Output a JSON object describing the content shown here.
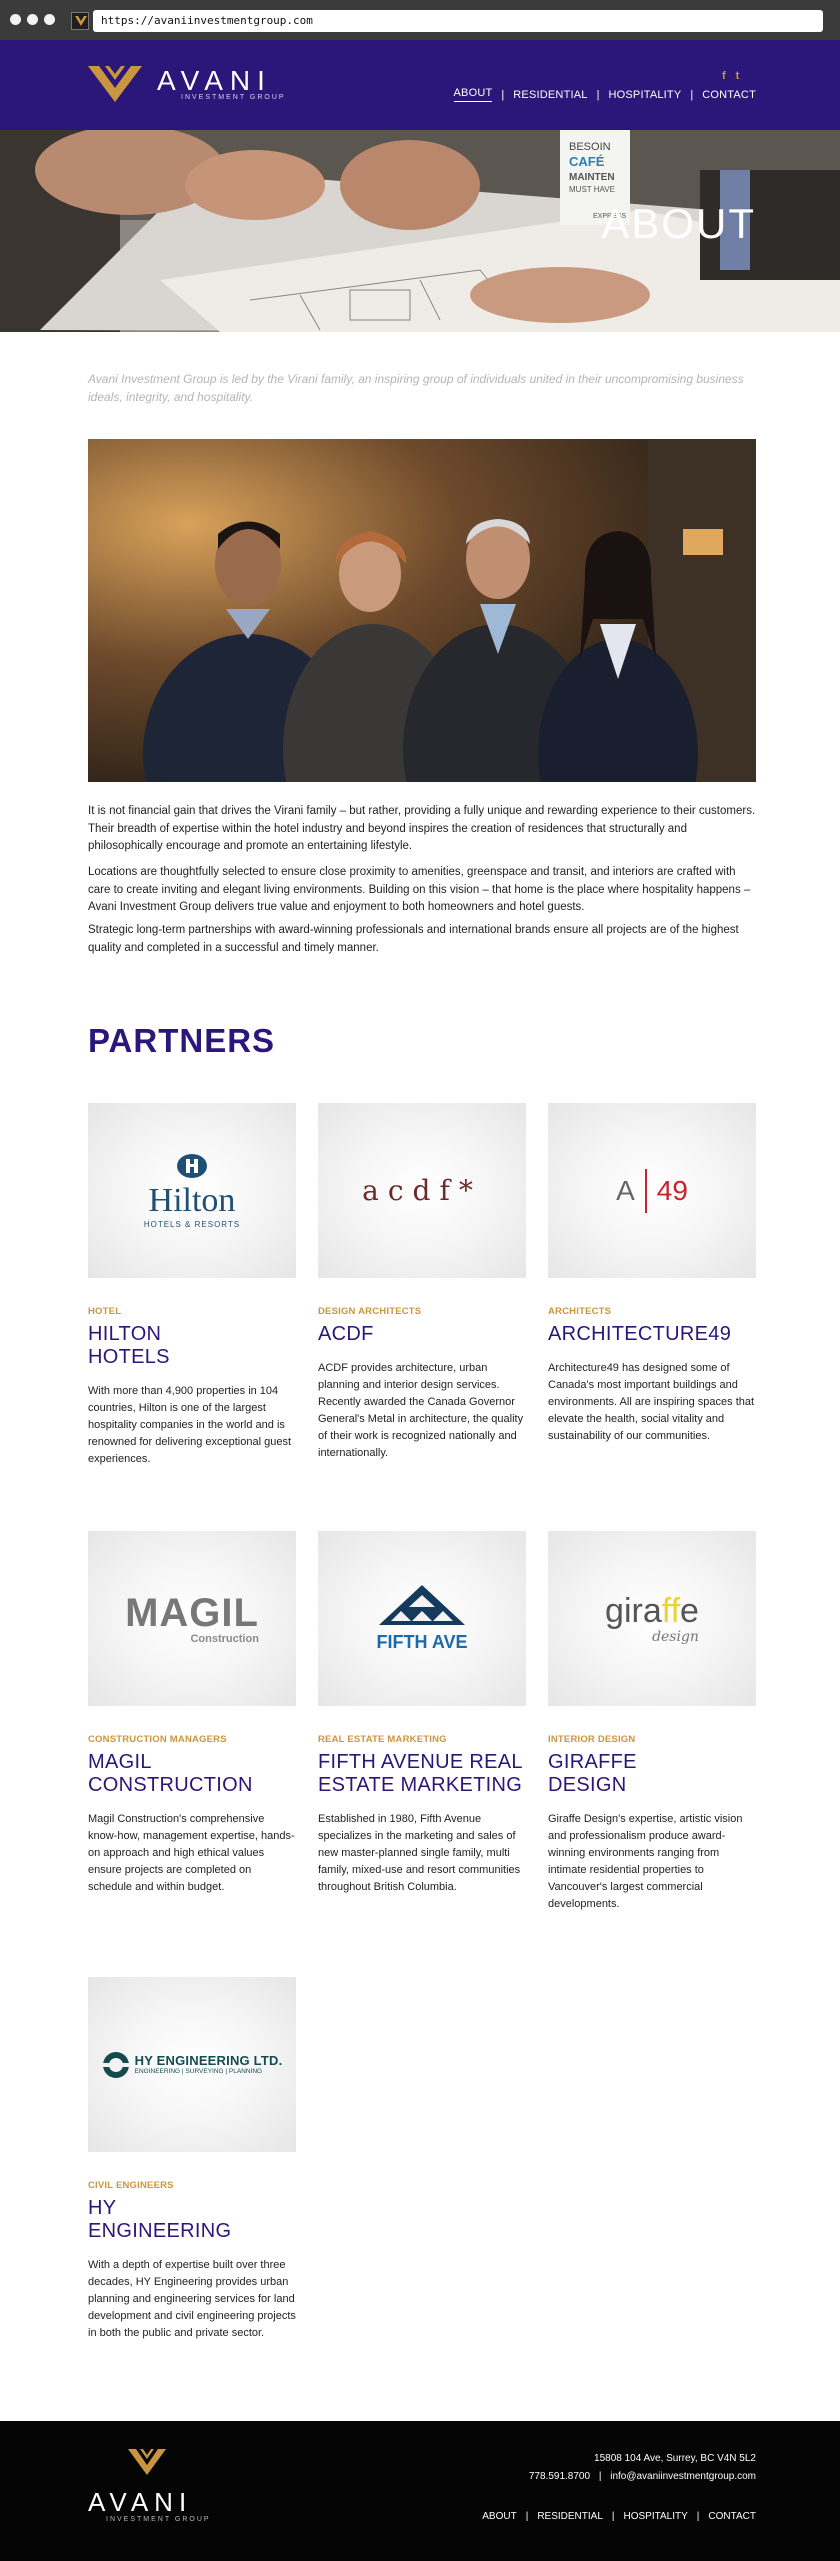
{
  "browser": {
    "url": "https://avaniinvestmentgroup.com"
  },
  "header": {
    "brand": "AVANI",
    "brand_sub": "INVESTMENT GROUP",
    "social": {
      "facebook": "f",
      "twitter": "t"
    },
    "nav": [
      {
        "label": "ABOUT"
      },
      {
        "label": "RESIDENTIAL"
      },
      {
        "label": "HOSPITALITY"
      },
      {
        "label": "CONTACT"
      }
    ]
  },
  "hero": {
    "title": "ABOUT",
    "cup_text": [
      "BESOIN",
      "CAFÉ",
      "MAINTEN",
      "MUST HAVE",
      "EXPRESS"
    ]
  },
  "intro": "Avani Investment Group is led by the Virani family, an inspiring group of individuals united in their uncompromising business ideals, integrity, and hospitality.",
  "paragraphs": [
    "It is not financial gain that drives the Virani family – but rather, providing a fully unique and rewarding experience to their customers. Their breadth of expertise within the hotel industry and beyond inspires the creation of residences that structurally and philosophically encourage and promote an entertaining lifestyle.",
    "Locations are thoughtfully selected to ensure close proximity to amenities, greenspace and transit, and interiors are crafted with care to create inviting and elegant living environments. Building on this vision – that home is the place where hospitality happens – Avani Investment Group delivers true value and enjoyment to both homeowners and hotel guests.",
    "Strategic long-term partnerships with award-winning professionals and international brands ensure all projects are of the highest quality and completed in a successful and timely manner."
  ],
  "partners": {
    "title": "PARTNERS",
    "items": [
      {
        "logo_text": "Hilton",
        "logo_sub": "HOTELS & RESORTS",
        "category": "HOTEL",
        "name": [
          "HILTON",
          "HOTELS"
        ],
        "description": "With more than 4,900 properties in 104 countries, Hilton is one of the largest hospitality companies in the world and is renowned for delivering exceptional guest experiences."
      },
      {
        "logo_text": "acdf*",
        "category": "DESIGN ARCHITECTS",
        "name": [
          "ACDF"
        ],
        "description": "ACDF provides architecture, urban planning and interior design services. Recently awarded the Canada Governor General's Metal in architecture, the quality of their work is recognized nationally and internationally."
      },
      {
        "logo_text_a": "A",
        "logo_text_b": "49",
        "category": "ARCHITECTS",
        "name": [
          "ARCHITECTURE49"
        ],
        "description": "Architecture49 has designed some of Canada's most important buildings and environments. All are inspiring spaces that elevate the health, social vitality and sustainability of our communities."
      },
      {
        "logo_text": "MAGIL",
        "logo_sub": "Construction",
        "category": "CONSTRUCTION MANAGERS",
        "name": [
          "MAGIL",
          "CONSTRUCTION"
        ],
        "description": "Magil Construction's comprehensive know-how, management expertise, hands-on approach and high ethical values ensure projects are completed on schedule and within budget."
      },
      {
        "logo_text": "FIFTH AVE",
        "category": "REAL ESTATE MARKETING",
        "name": [
          "FIFTH AVENUE REAL",
          "ESTATE MARKETING"
        ],
        "description": "Established in 1980, Fifth Avenue specializes in the marketing and sales of new master-planned single family, multi family, mixed-use and resort communities throughout British Columbia."
      },
      {
        "logo_text_a": "gira",
        "logo_text_b": "ff",
        "logo_text_c": "e",
        "logo_sub": "design",
        "category": "INTERIOR DESIGN",
        "name": [
          "GIRAFFE",
          "DESIGN"
        ],
        "description": "Giraffe Design's expertise, artistic vision and professionalism produce award-winning environments ranging from intimate residential properties to Vancouver's largest commercial developments."
      },
      {
        "logo_text": "HY ENGINEERING LTD.",
        "logo_sub": "ENGINEERING | SURVEYING | PLANNING",
        "category": "CIVIL ENGINEERS",
        "name": [
          "HY",
          "ENGINEERING"
        ],
        "description": "With a depth of expertise built over three decades, HY Engineering provides urban planning and engineering services for land development and civil engineering projects in both the public and private sector."
      }
    ]
  },
  "footer": {
    "brand": "AVANI",
    "brand_sub": "INVESTMENT GROUP",
    "address": "15808 104 Ave, Surrey, BC V4N 5L2",
    "phone": "778.591.8700",
    "email": "info@avaniinvestmentgroup.com",
    "nav": [
      {
        "label": "ABOUT"
      },
      {
        "label": "RESIDENTIAL"
      },
      {
        "label": "HOSPITALITY"
      },
      {
        "label": "CONTACT"
      }
    ]
  },
  "colors": {
    "brand_purple": "#2b167a",
    "accent_gold": "#c9963f",
    "footer_black": "#050505"
  }
}
